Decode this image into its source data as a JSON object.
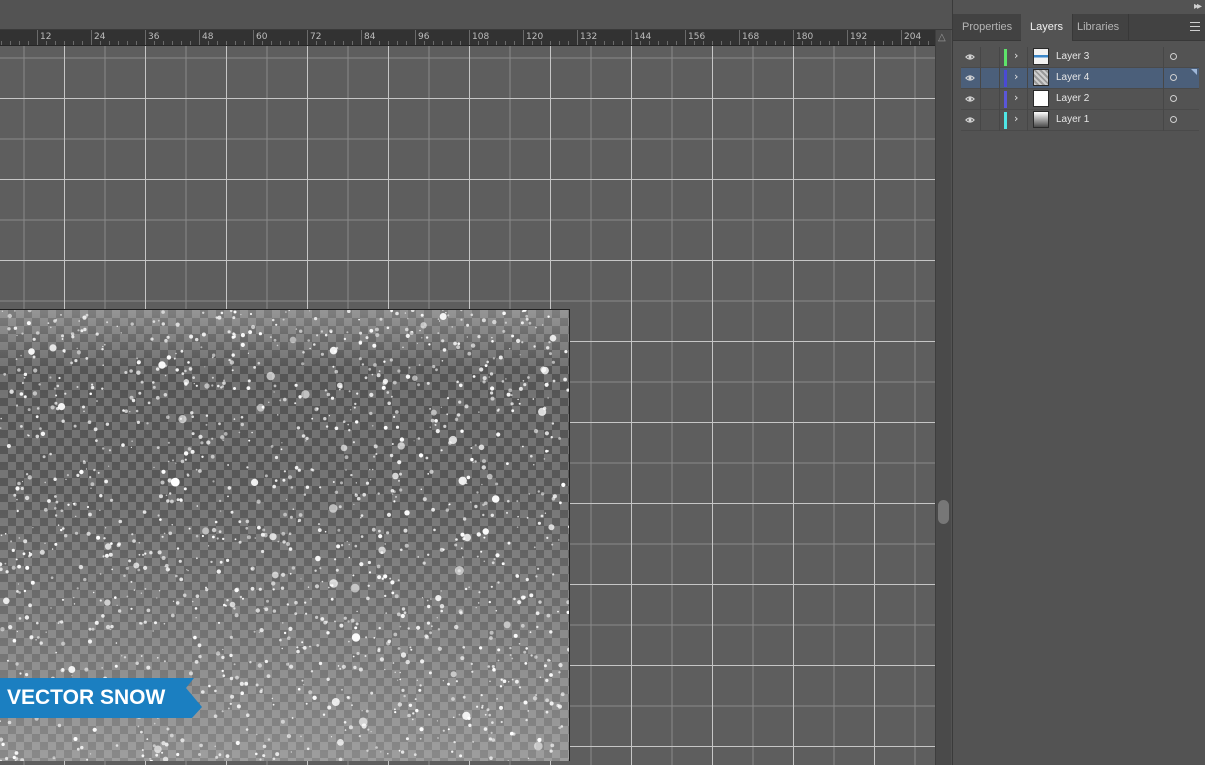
{
  "ruler": {
    "labels": [
      "12",
      "24",
      "36",
      "48",
      "60",
      "72",
      "84",
      "96",
      "108",
      "120",
      "132",
      "144",
      "156",
      "168",
      "180",
      "192",
      "204"
    ]
  },
  "artwork": {
    "banner_text": "VECTOR SNOW",
    "banner_color": "#1b7fc1"
  },
  "panel": {
    "tabs": [
      {
        "label": "Properties",
        "active": false
      },
      {
        "label": "Layers",
        "active": true
      },
      {
        "label": "Libraries",
        "active": false
      }
    ],
    "layers": [
      {
        "name": "Layer 3",
        "color": "#5ee36a",
        "selected": false,
        "visible": true,
        "thumb": "banner"
      },
      {
        "name": "Layer 4",
        "color": "#4a4ad6",
        "selected": true,
        "visible": true,
        "thumb": "snow"
      },
      {
        "name": "Layer 2",
        "color": "#5a56d8",
        "selected": false,
        "visible": true,
        "thumb": "white"
      },
      {
        "name": "Layer 1",
        "color": "#4fe6e6",
        "selected": false,
        "visible": true,
        "thumb": "gradient"
      }
    ]
  },
  "colors": {
    "selected_row": "#4b5f7a",
    "canvas_bg": "#5e5e5e",
    "panel_bg": "#535353"
  }
}
